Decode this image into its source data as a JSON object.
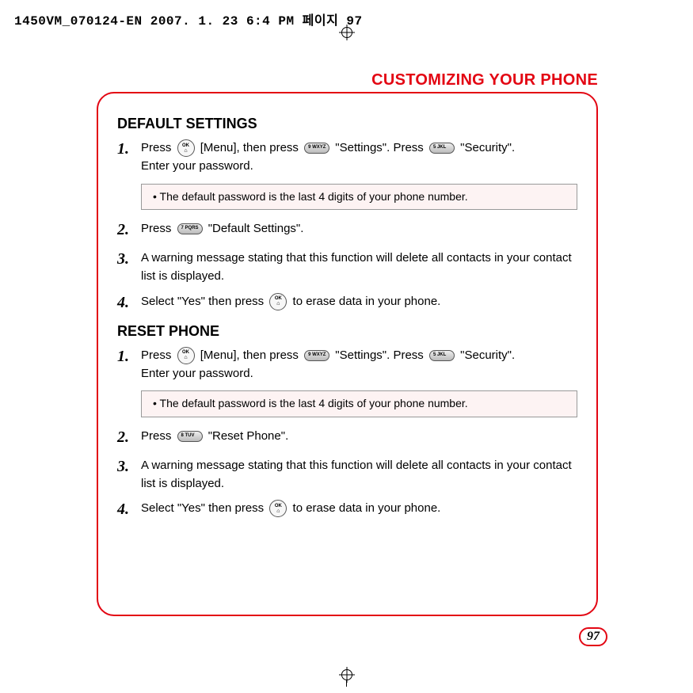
{
  "print_header": "1450VM_070124-EN  2007. 1. 23  6:4 PM  페이지 97",
  "page_title": "CUSTOMIZING YOUR PHONE",
  "page_number": "97",
  "sections": {
    "default_settings": {
      "heading": "DEFAULT SETTINGS",
      "steps": [
        {
          "num": "1.",
          "parts": {
            "a": "Press ",
            "b": " [Menu], then press ",
            "c": " \"Settings\". Press ",
            "d": " \"Security\".",
            "e": "Enter your password."
          }
        },
        {
          "num": "2.",
          "parts": {
            "a": "Press ",
            "b": " \"Default Settings\"."
          }
        },
        {
          "num": "3.",
          "text": "A warning message stating that this function will delete all contacts in your contact list is displayed."
        },
        {
          "num": "4.",
          "parts": {
            "a": "Select \"Yes\" then press ",
            "b": " to erase data in your phone."
          }
        }
      ],
      "note": "The default password is the last 4 digits of your phone number."
    },
    "reset_phone": {
      "heading": "RESET PHONE",
      "steps": [
        {
          "num": "1.",
          "parts": {
            "a": "Press ",
            "b": " [Menu], then press ",
            "c": " \"Settings\". Press ",
            "d": " \"Security\".",
            "e": "Enter your password."
          }
        },
        {
          "num": "2.",
          "parts": {
            "a": "Press ",
            "b": " \"Reset Phone\"."
          }
        },
        {
          "num": "3.",
          "text": "A warning message stating that this function will delete all contacts in your contact list is displayed."
        },
        {
          "num": "4.",
          "parts": {
            "a": "Select \"Yes\" then press ",
            "b": " to erase data in your phone."
          }
        }
      ],
      "note": "The default password is the last 4 digits of your phone number."
    }
  },
  "keys": {
    "ok_top": "OK",
    "ok_bot": "⌂",
    "k9": "9 WXYZ",
    "k5": "5 JKL",
    "k7": "7 PQRS",
    "k8": "8 TUV"
  }
}
